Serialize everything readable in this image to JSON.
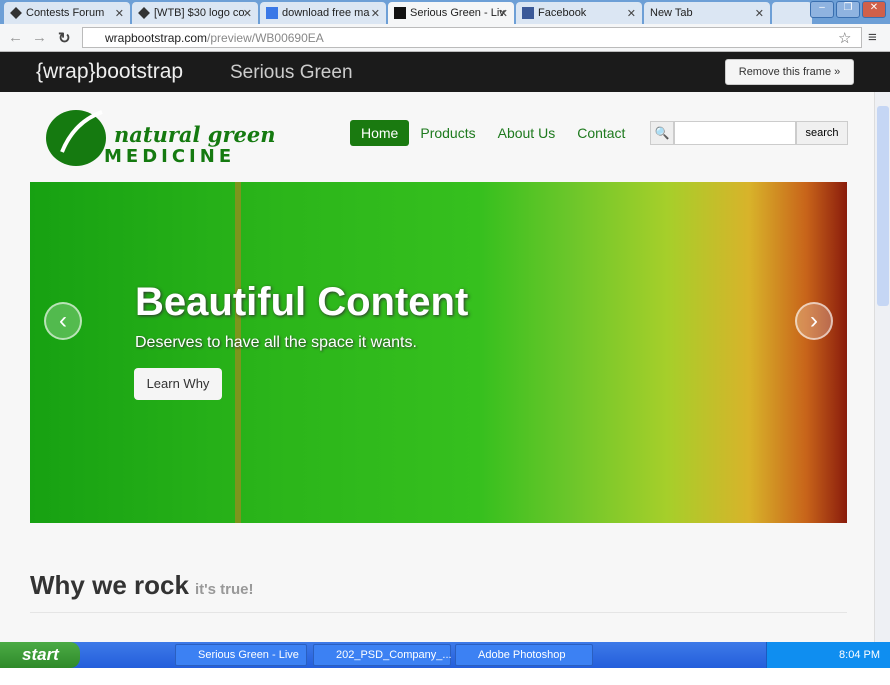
{
  "browser": {
    "tabs": [
      {
        "label": "Contests Forum"
      },
      {
        "label": "[WTB] $30 logo co"
      },
      {
        "label": "download free ma"
      },
      {
        "label": "Serious Green - Liv"
      },
      {
        "label": "Facebook"
      },
      {
        "label": "New Tab"
      }
    ],
    "url_host": "wrapbootstrap.com",
    "url_path": "/preview/WB00690EA"
  },
  "wrapbar": {
    "logo": "{wrap}bootstrap",
    "theme": "Serious Green",
    "remove": "Remove this frame »"
  },
  "site": {
    "logo_top": "natural green",
    "logo_bottom": "MEDICINE",
    "menu": [
      "Home",
      "Products",
      "About Us",
      "Contact"
    ],
    "search_button": "search",
    "hero": {
      "title": "Beautiful Content",
      "subtitle": "Deserves to have all the space it wants.",
      "button": "Learn Why",
      "prev": "‹",
      "next": "›"
    },
    "section_title": "Why we rock",
    "section_sub": "it's true!"
  },
  "taskbar": {
    "start": "start",
    "items": [
      "Serious Green - Live ...",
      "202_PSD_Company_...",
      "Adobe Photoshop"
    ],
    "clock": "8:04 PM"
  }
}
